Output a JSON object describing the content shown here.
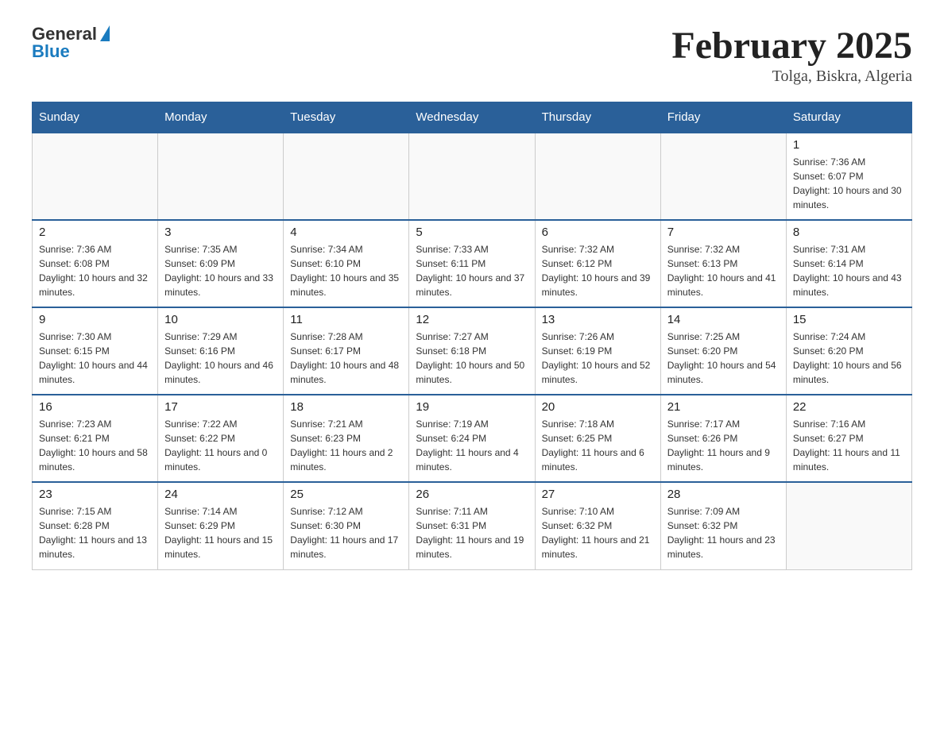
{
  "logo": {
    "general": "General",
    "blue": "Blue"
  },
  "title": "February 2025",
  "subtitle": "Tolga, Biskra, Algeria",
  "days_of_week": [
    "Sunday",
    "Monday",
    "Tuesday",
    "Wednesday",
    "Thursday",
    "Friday",
    "Saturday"
  ],
  "weeks": [
    [
      {
        "day": "",
        "info": ""
      },
      {
        "day": "",
        "info": ""
      },
      {
        "day": "",
        "info": ""
      },
      {
        "day": "",
        "info": ""
      },
      {
        "day": "",
        "info": ""
      },
      {
        "day": "",
        "info": ""
      },
      {
        "day": "1",
        "info": "Sunrise: 7:36 AM\nSunset: 6:07 PM\nDaylight: 10 hours and 30 minutes."
      }
    ],
    [
      {
        "day": "2",
        "info": "Sunrise: 7:36 AM\nSunset: 6:08 PM\nDaylight: 10 hours and 32 minutes."
      },
      {
        "day": "3",
        "info": "Sunrise: 7:35 AM\nSunset: 6:09 PM\nDaylight: 10 hours and 33 minutes."
      },
      {
        "day": "4",
        "info": "Sunrise: 7:34 AM\nSunset: 6:10 PM\nDaylight: 10 hours and 35 minutes."
      },
      {
        "day": "5",
        "info": "Sunrise: 7:33 AM\nSunset: 6:11 PM\nDaylight: 10 hours and 37 minutes."
      },
      {
        "day": "6",
        "info": "Sunrise: 7:32 AM\nSunset: 6:12 PM\nDaylight: 10 hours and 39 minutes."
      },
      {
        "day": "7",
        "info": "Sunrise: 7:32 AM\nSunset: 6:13 PM\nDaylight: 10 hours and 41 minutes."
      },
      {
        "day": "8",
        "info": "Sunrise: 7:31 AM\nSunset: 6:14 PM\nDaylight: 10 hours and 43 minutes."
      }
    ],
    [
      {
        "day": "9",
        "info": "Sunrise: 7:30 AM\nSunset: 6:15 PM\nDaylight: 10 hours and 44 minutes."
      },
      {
        "day": "10",
        "info": "Sunrise: 7:29 AM\nSunset: 6:16 PM\nDaylight: 10 hours and 46 minutes."
      },
      {
        "day": "11",
        "info": "Sunrise: 7:28 AM\nSunset: 6:17 PM\nDaylight: 10 hours and 48 minutes."
      },
      {
        "day": "12",
        "info": "Sunrise: 7:27 AM\nSunset: 6:18 PM\nDaylight: 10 hours and 50 minutes."
      },
      {
        "day": "13",
        "info": "Sunrise: 7:26 AM\nSunset: 6:19 PM\nDaylight: 10 hours and 52 minutes."
      },
      {
        "day": "14",
        "info": "Sunrise: 7:25 AM\nSunset: 6:20 PM\nDaylight: 10 hours and 54 minutes."
      },
      {
        "day": "15",
        "info": "Sunrise: 7:24 AM\nSunset: 6:20 PM\nDaylight: 10 hours and 56 minutes."
      }
    ],
    [
      {
        "day": "16",
        "info": "Sunrise: 7:23 AM\nSunset: 6:21 PM\nDaylight: 10 hours and 58 minutes."
      },
      {
        "day": "17",
        "info": "Sunrise: 7:22 AM\nSunset: 6:22 PM\nDaylight: 11 hours and 0 minutes."
      },
      {
        "day": "18",
        "info": "Sunrise: 7:21 AM\nSunset: 6:23 PM\nDaylight: 11 hours and 2 minutes."
      },
      {
        "day": "19",
        "info": "Sunrise: 7:19 AM\nSunset: 6:24 PM\nDaylight: 11 hours and 4 minutes."
      },
      {
        "day": "20",
        "info": "Sunrise: 7:18 AM\nSunset: 6:25 PM\nDaylight: 11 hours and 6 minutes."
      },
      {
        "day": "21",
        "info": "Sunrise: 7:17 AM\nSunset: 6:26 PM\nDaylight: 11 hours and 9 minutes."
      },
      {
        "day": "22",
        "info": "Sunrise: 7:16 AM\nSunset: 6:27 PM\nDaylight: 11 hours and 11 minutes."
      }
    ],
    [
      {
        "day": "23",
        "info": "Sunrise: 7:15 AM\nSunset: 6:28 PM\nDaylight: 11 hours and 13 minutes."
      },
      {
        "day": "24",
        "info": "Sunrise: 7:14 AM\nSunset: 6:29 PM\nDaylight: 11 hours and 15 minutes."
      },
      {
        "day": "25",
        "info": "Sunrise: 7:12 AM\nSunset: 6:30 PM\nDaylight: 11 hours and 17 minutes."
      },
      {
        "day": "26",
        "info": "Sunrise: 7:11 AM\nSunset: 6:31 PM\nDaylight: 11 hours and 19 minutes."
      },
      {
        "day": "27",
        "info": "Sunrise: 7:10 AM\nSunset: 6:32 PM\nDaylight: 11 hours and 21 minutes."
      },
      {
        "day": "28",
        "info": "Sunrise: 7:09 AM\nSunset: 6:32 PM\nDaylight: 11 hours and 23 minutes."
      },
      {
        "day": "",
        "info": ""
      }
    ]
  ]
}
